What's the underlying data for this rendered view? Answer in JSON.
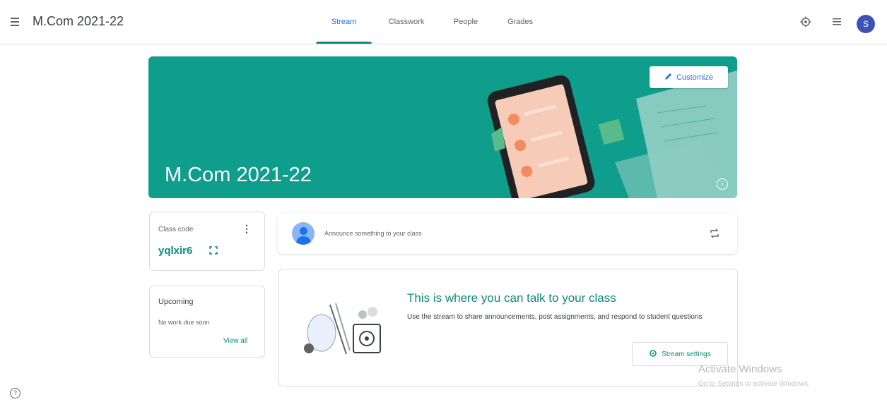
{
  "header": {
    "title": "M.Com 2021-22",
    "tabs": [
      {
        "label": "Stream",
        "active": true
      },
      {
        "label": "Classwork",
        "active": false
      },
      {
        "label": "People",
        "active": false
      },
      {
        "label": "Grades",
        "active": false
      }
    ],
    "avatar_letter": "S"
  },
  "banner": {
    "title": "M.Com 2021-22",
    "customize_label": "Customize"
  },
  "class_code": {
    "label": "Class code",
    "value": "yqlxir6"
  },
  "upcoming": {
    "title": "Upcoming",
    "subtitle": "No work due soon",
    "view_all": "View all"
  },
  "announce": {
    "placeholder": "Announce something to your class"
  },
  "empty_state": {
    "title": "This is where you can talk to your class",
    "description": "Use the stream to share announcements, post assignments, and respond to student questions",
    "settings_button": "Stream settings"
  },
  "watermark": {
    "title": "Activate Windows",
    "subtitle": "Go to Settings to activate Windows."
  },
  "colors": {
    "banner": "#0f9d8c",
    "accent": "#0d8a7a",
    "avatar": "#3f51b5"
  }
}
